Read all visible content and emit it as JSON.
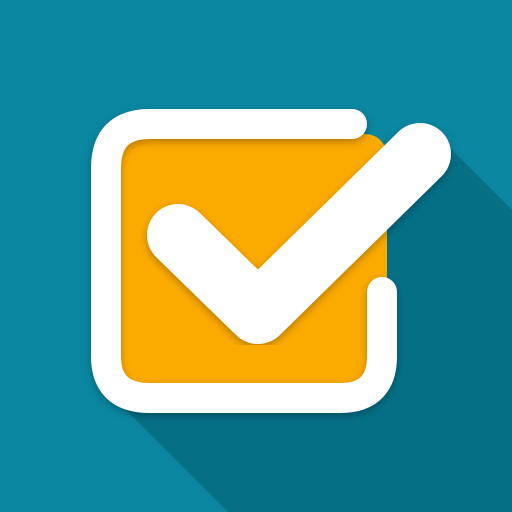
{
  "icon": {
    "name": "checkbox-checked-icon",
    "colors": {
      "background": "#0a86a0",
      "long_shadow": "#056f86",
      "box_fill": "#fbaa00",
      "outline_and_check": "#ffffff"
    }
  }
}
